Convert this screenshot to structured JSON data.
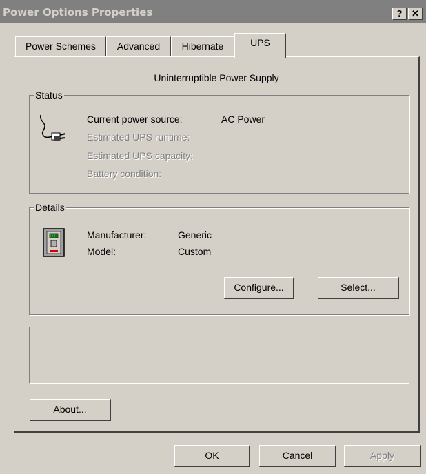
{
  "window": {
    "title": "Power Options Properties",
    "help_label": "?",
    "close_label": "✕"
  },
  "tabs": [
    {
      "label": "Power Schemes"
    },
    {
      "label": "Advanced"
    },
    {
      "label": "Hibernate"
    },
    {
      "label": "UPS",
      "active": true
    }
  ],
  "ups": {
    "header": "Uninterruptible Power Supply",
    "status": {
      "legend": "Status",
      "current_power_source_label": "Current power source:",
      "current_power_source_value": "AC Power",
      "runtime_label": "Estimated UPS runtime:",
      "capacity_label": "Estimated UPS capacity:",
      "battery_label": "Battery condition:",
      "icon": "power-plug-icon"
    },
    "details": {
      "legend": "Details",
      "manufacturer_label": "Manufacturer:",
      "manufacturer_value": "Generic",
      "model_label": "Model:",
      "model_value": "Custom",
      "configure_label": "Configure...",
      "select_label": "Select...",
      "icon": "ups-device-icon"
    },
    "about_label": "About..."
  },
  "footer": {
    "ok_label": "OK",
    "cancel_label": "Cancel",
    "apply_label": "Apply"
  }
}
